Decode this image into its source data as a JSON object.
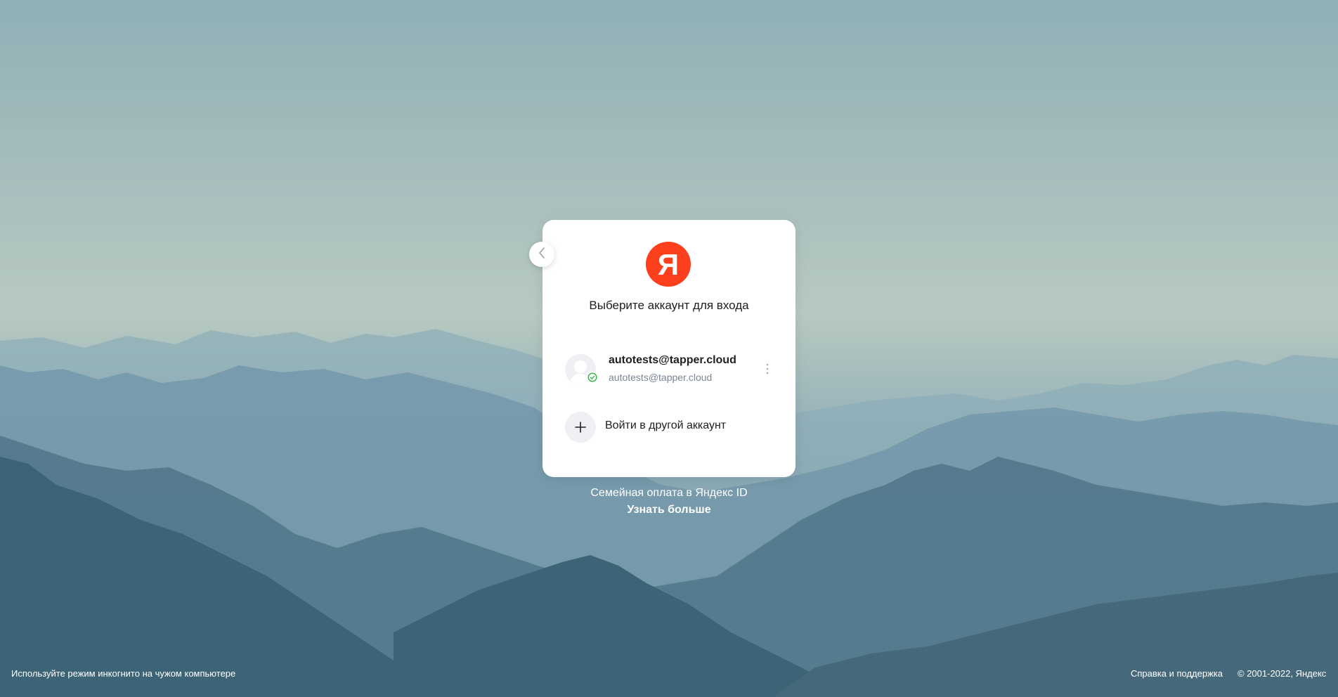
{
  "colors": {
    "brand": "#fc3f1d",
    "card_bg": "#ffffff",
    "text_primary": "#21201f",
    "text_secondary": "#7b8595",
    "verified": "#2bb641"
  },
  "logo": {
    "letter": "Я",
    "icon": "yandex-logo-icon"
  },
  "card": {
    "title": "Выберите аккаунт для входа",
    "back_icon": "chevron-left-icon"
  },
  "accounts": [
    {
      "login": "autotests@tapper.cloud",
      "email": "autotests@tapper.cloud",
      "avatar_icon": "user-avatar-icon",
      "status_icon": "check-circle-icon",
      "menu_icon": "more-vertical-icon"
    }
  ],
  "add_account": {
    "label": "Войти в другой аккаунт",
    "icon": "plus-icon"
  },
  "promo": {
    "text": "Семейная оплата в Яндекс ID",
    "link": "Узнать больше"
  },
  "footer": {
    "incognito_hint": "Используйте режим инкогнито на чужом компьютере",
    "help_link": "Справка и поддержка",
    "copyright": "© 2001-2022, Яндекс"
  }
}
